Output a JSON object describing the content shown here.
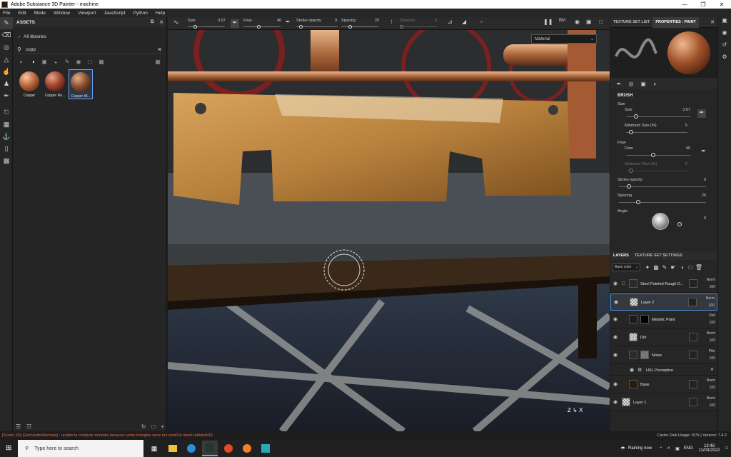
{
  "window": {
    "title": "Adobe Substance 3D Painter - machine",
    "app_icon": "Pt"
  },
  "menu": [
    "File",
    "Edit",
    "Mode",
    "Window",
    "Viewport",
    "JavaScript",
    "Python",
    "Help"
  ],
  "tools": [
    "paint-brush",
    "eraser",
    "projection",
    "polygon-fill",
    "smudge",
    "clone",
    "color-picker",
    "bake",
    "geometry-mask",
    "anchor",
    "baking",
    "scene"
  ],
  "assets": {
    "title": "ASSETS",
    "library": "All libraries",
    "search_value": "copp",
    "items": [
      {
        "label": "Copper",
        "color": "#b8663a"
      },
      {
        "label": "Copper Re...",
        "color": "#a0442c"
      },
      {
        "label": "Copper W...",
        "color": "#8a5230"
      }
    ]
  },
  "context_bar": {
    "size_label": "Size",
    "size_value": "3.07",
    "flow_label": "Flow",
    "flow_value": "40",
    "stroke_label": "Stroke opacity",
    "stroke_value": "9",
    "spacing_label": "Spacing",
    "spacing_value": "20",
    "distance_label": "Distance",
    "distance_value": "0",
    "render_mode": "BM"
  },
  "viewport": {
    "channel": "Material"
  },
  "right": {
    "tab_texture": "TEXTURE SET LIST",
    "tab_properties": "PROPERTIES - PAINT",
    "brush_title": "BRUSH",
    "size_group": "Size",
    "size_label": "Size",
    "size_value": "3.07",
    "size_level": 0.13,
    "minsize_label": "Minimum Size (%)",
    "minsize_value": "5",
    "minsize_level": 0.05,
    "flow_group": "Flow",
    "flow_label": "Flow",
    "flow_value": "40",
    "flow_level": 0.4,
    "minflow_label": "Minimum Flow (%)",
    "minflow_value": "5",
    "minflow_level": 0.05,
    "stroke_label": "Stroke opacity",
    "stroke_value": "9",
    "stroke_level": 0.09,
    "spacing_label": "Spacing",
    "spacing_value": "20",
    "spacing_level": 0.2,
    "angle_label": "Angle",
    "angle_value": "0"
  },
  "layers": {
    "tab_layers": "LAYERS",
    "tab_settings": "TEXTURE SET SETTINGS",
    "channel": "Base color",
    "rows": [
      {
        "name": "Steel Painted Rough D...",
        "blend": "Norm",
        "opacity": "100"
      },
      {
        "name": "Layer 2",
        "blend": "Norm",
        "opacity": "100"
      },
      {
        "name": "Metallic Paint",
        "blend": "Ovrl",
        "opacity": "100"
      },
      {
        "name": "Dirt",
        "blend": "Norm",
        "opacity": "100"
      },
      {
        "name": "Noise",
        "blend": "Pthr",
        "opacity": "100"
      },
      {
        "name": "HSL Perceptive"
      },
      {
        "name": "Base",
        "blend": "Norm",
        "opacity": "100"
      },
      {
        "name": "Layer 1",
        "blend": "Norm",
        "opacity": "100"
      }
    ]
  },
  "status": {
    "error": "[Scene 3D] [GenVertexNormals] : unable to compute normals because some triangles were too small in mesh tablebolt15",
    "cache": "Cache Disk Usage:  91% | Version: 7.4.2"
  },
  "taskbar": {
    "search_placeholder": "Type here to search",
    "weather": "Raining now",
    "lang": "ENG",
    "time": "13:48",
    "date": "11/03/2022"
  }
}
